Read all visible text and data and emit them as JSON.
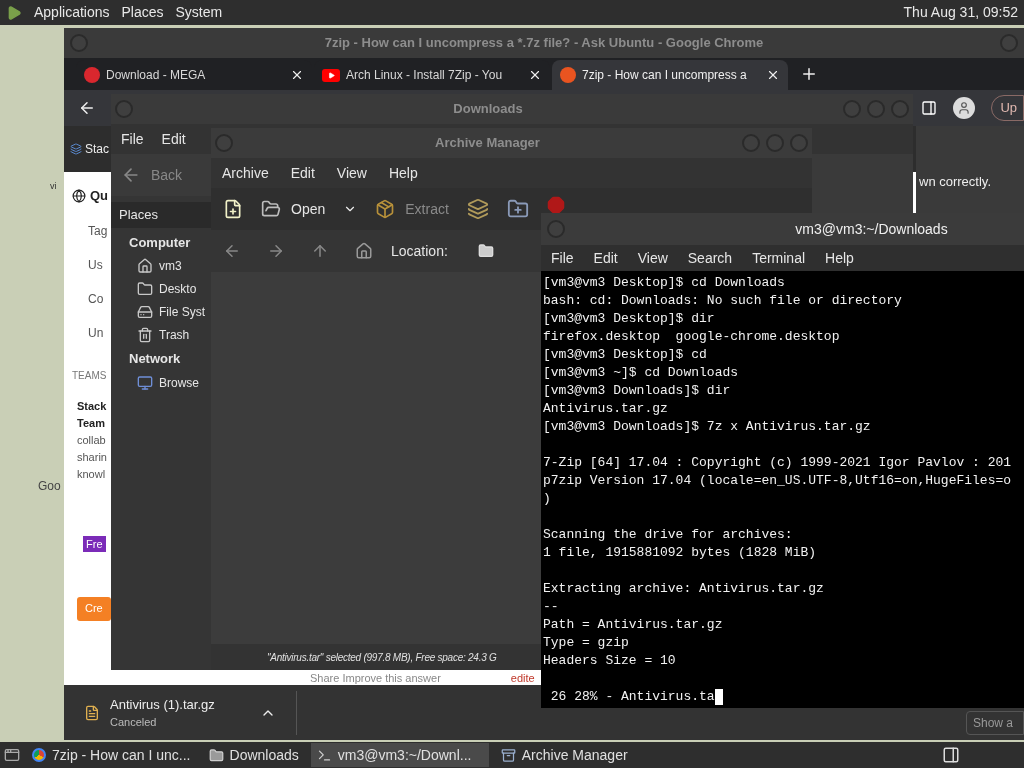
{
  "top_panel": {
    "menus": [
      "Applications",
      "Places",
      "System"
    ],
    "clock": "Thu Aug 31, 09:52"
  },
  "desktop": {
    "labels": [
      "vi",
      "Goo"
    ]
  },
  "chrome": {
    "title": "7zip - How can I uncompress a *.7z file? - Ask Ubuntu - Google Chrome",
    "tabs": [
      {
        "label": "Download - MEGA",
        "kind": "mega",
        "selected": false
      },
      {
        "label": "Arch Linux - Install 7Zip - You",
        "kind": "youtube",
        "selected": false
      },
      {
        "label": "7zip - How can I uncompress a",
        "kind": "ask",
        "selected": true
      }
    ],
    "update_button": "Up",
    "page": {
      "header": "Stac",
      "nav_title": "Qu",
      "nav_items": [
        "Tag",
        "Us",
        "Co",
        "Un"
      ],
      "teams_label": "TEAMS",
      "promo_title": [
        "Stack",
        "Team"
      ],
      "promo_lines": [
        "collab",
        "sharin",
        "knowl"
      ],
      "promo_badge": "Fre",
      "promo_button": "Cre",
      "answer_actions": "Share  Improve this answer",
      "edited": "edite",
      "notice": "wn correctly.",
      "show_all": "Show a"
    },
    "download": {
      "name": "Antivirus (1).tar.gz",
      "status": "Canceled"
    }
  },
  "files_window": {
    "title": "Downloads",
    "menus": [
      "File",
      "Edit"
    ],
    "back": "Back",
    "pane_header": "Places",
    "sections": [
      {
        "title": "Computer",
        "items": [
          {
            "label": "vm3",
            "kind": "home"
          },
          {
            "label": "Deskto",
            "kind": "folder"
          },
          {
            "label": "File Syst",
            "kind": "drive"
          },
          {
            "label": "Trash",
            "kind": "trash"
          }
        ]
      },
      {
        "title": "Network",
        "items": [
          {
            "label": "Browse",
            "kind": "network"
          }
        ]
      }
    ]
  },
  "archive_window": {
    "title": "Archive Manager",
    "menus": [
      "Archive",
      "Edit",
      "View",
      "Help"
    ],
    "tools": [
      {
        "kind": "new"
      },
      {
        "kind": "open",
        "label": "Open",
        "disabled": false
      },
      {
        "kind": "dropdown"
      },
      {
        "kind": "extract",
        "label": "Extract",
        "disabled": true
      },
      {
        "kind": "add-files"
      },
      {
        "kind": "add-folder"
      },
      {
        "kind": "stop"
      }
    ],
    "location_label": "Location:",
    "status": "\"Antivirus.tar\" selected (997.8 MB), Free space: 24.3 G"
  },
  "terminal": {
    "title": "vm3@vm3:~/Downloads",
    "menus": [
      "File",
      "Edit",
      "View",
      "Search",
      "Terminal",
      "Help"
    ],
    "blocks": [
      [
        "[vm3@vm3 Desktop]$ cd Downloads",
        "bash: cd: Downloads: No such file or directory",
        "[vm3@vm3 Desktop]$ dir",
        "firefox.desktop  google-chrome.desktop",
        "[vm3@vm3 Desktop]$ cd",
        "[vm3@vm3 ~]$ cd Downloads",
        "[vm3@vm3 Downloads]$ dir",
        "Antivirus.tar.gz",
        "[vm3@vm3 Downloads]$ 7z x Antivirus.tar.gz"
      ],
      [
        "7-Zip [64] 17.04 : Copyright (c) 1999-2021 Igor Pavlov : 201",
        "p7zip Version 17.04 (locale=en_US.UTF-8,Utf16=on,HugeFiles=o",
        ")"
      ],
      [
        "Scanning the drive for archives:",
        "1 file, 1915881092 bytes (1828 MiB)"
      ],
      [
        "Extracting archive: Antivirus.tar.gz",
        "--",
        "Path = Antivirus.tar.gz",
        "Type = gzip",
        "Headers Size = 10"
      ],
      [
        " 26 28% - Antivirus.ta"
      ]
    ]
  },
  "taskbar": [
    {
      "label": "7zip - How can I unc...",
      "kind": "browser",
      "selected": false
    },
    {
      "label": "Downloads",
      "kind": "folder",
      "selected": false
    },
    {
      "label": "vm3@vm3:~/Downl...",
      "kind": "terminal",
      "selected": true
    },
    {
      "label": "Archive Manager",
      "kind": "archive",
      "selected": false
    }
  ]
}
